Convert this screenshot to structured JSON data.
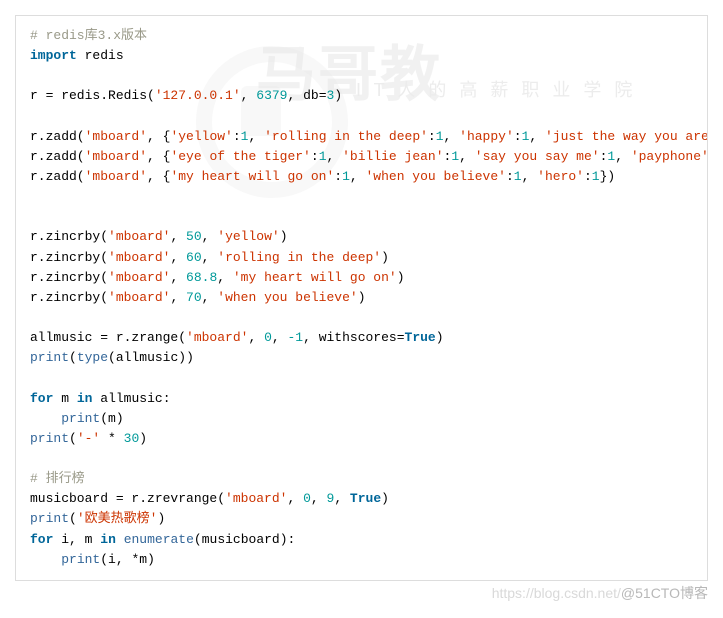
{
  "code": {
    "l1_comment": "# redis库3.x版本",
    "l2_import": "import",
    "l2_pkg": "redis",
    "l3_lhs": "r = redis.Redis(",
    "l3_s1": "'127.0.0.1'",
    "l3_num1": "6379",
    "l3_kw": "db",
    "l3_num2": "3",
    "zadd_fn": "r.zadd(",
    "mboard": "'mboard'",
    "z1_k1": "'yellow'",
    "z1_v": "1",
    "z1_k2": "'rolling in the deep'",
    "z1_k3": "'happy'",
    "z1_k4": "'just the way you are'",
    "z2_k1": "'eye of the tiger'",
    "z2_k2": "'billie jean'",
    "z2_k3": "'say you say me'",
    "z2_k4": "'payphone'",
    "z3_k1": "'my heart will go on'",
    "z3_k2": "'when you believe'",
    "z3_k3": "'hero'",
    "zincrby": "r.zincrby(",
    "zi1_n": "50",
    "zi1_s": "'yellow'",
    "zi2_n": "60",
    "zi2_s": "'rolling in the deep'",
    "zi3_n": "68.8",
    "zi3_s": "'my heart will go on'",
    "zi4_n": "70",
    "zi4_s": "'when you believe'",
    "allmusic_lhs": "allmusic = r.zrange(",
    "range_a": "0",
    "range_b": "-1",
    "withscores": "withscores",
    "True": "True",
    "print": "print",
    "type": "type",
    "allmusic_id": "allmusic",
    "for": "for",
    "in": "in",
    "m": "m",
    "dash": "'-'",
    "mul30": "30",
    "comment2": "# 排行榜",
    "musicboard_lhs": "musicboard = r.zrevrange(",
    "rev_a": "0",
    "rev_b": "9",
    "pstr": "'欧美热歌榜'",
    "enumerate": "enumerate",
    "i": "i",
    "musicboard_id": "musicboard",
    "star": "*"
  },
  "attribution": {
    "url": "https://blog.csdn.net/",
    "tag": "@51CTO博客"
  },
  "watermark": {
    "logo": "马哥教",
    "sub": "I T 人 的 高 薪 职 业 学 院"
  }
}
